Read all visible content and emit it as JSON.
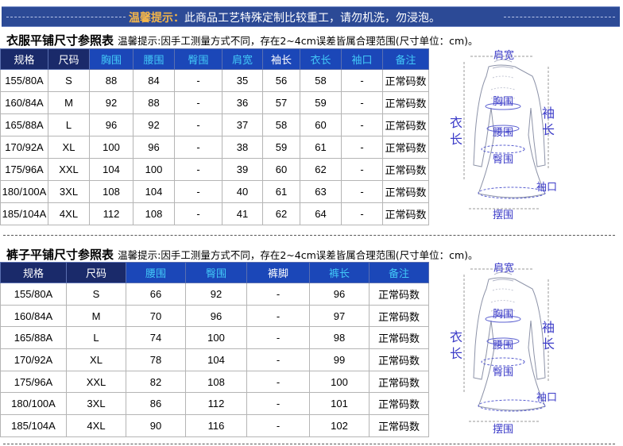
{
  "banner": {
    "lead": "温馨提示：",
    "text": "此商品工艺特殊定制比较重工，请勿机洗，勿浸泡。"
  },
  "top_section": {
    "title": "衣服平铺尺寸参照表",
    "note": "温馨提示:因手工测量方式不同，存在2~4cm误差皆属合理范围(尺寸单位：cm)。",
    "headers": [
      "规格",
      "尺码",
      "胸围",
      "腰围",
      "臀围",
      "肩宽",
      "袖长",
      "衣长",
      "袖口",
      "备注"
    ],
    "rows": [
      [
        "155/80A",
        "S",
        "88",
        "84",
        "-",
        "35",
        "56",
        "58",
        "-",
        "正常码数"
      ],
      [
        "160/84A",
        "M",
        "92",
        "88",
        "-",
        "36",
        "57",
        "59",
        "-",
        "正常码数"
      ],
      [
        "165/88A",
        "L",
        "96",
        "92",
        "-",
        "37",
        "58",
        "60",
        "-",
        "正常码数"
      ],
      [
        "170/92A",
        "XL",
        "100",
        "96",
        "-",
        "38",
        "59",
        "61",
        "-",
        "正常码数"
      ],
      [
        "175/96A",
        "XXL",
        "104",
        "100",
        "-",
        "39",
        "60",
        "62",
        "-",
        "正常码数"
      ],
      [
        "180/100A",
        "3XL",
        "108",
        "104",
        "-",
        "40",
        "61",
        "63",
        "-",
        "正常码数"
      ],
      [
        "185/104A",
        "4XL",
        "112",
        "108",
        "-",
        "41",
        "62",
        "64",
        "-",
        "正常码数"
      ]
    ]
  },
  "bottom_section": {
    "title": "裤子平铺尺寸参照表",
    "note": "温馨提示:因手工测量方式不同，存在2~4cm误差皆属合理范围(尺寸单位：cm)。",
    "headers": [
      "规格",
      "尺码",
      "腰围",
      "臀围",
      "裤脚",
      "裤长",
      "备注"
    ],
    "rows": [
      [
        "155/80A",
        "S",
        "66",
        "92",
        "-",
        "96",
        "正常码数"
      ],
      [
        "160/84A",
        "M",
        "70",
        "96",
        "-",
        "97",
        "正常码数"
      ],
      [
        "165/88A",
        "L",
        "74",
        "100",
        "-",
        "98",
        "正常码数"
      ],
      [
        "170/92A",
        "XL",
        "78",
        "104",
        "-",
        "99",
        "正常码数"
      ],
      [
        "175/96A",
        "XXL",
        "82",
        "108",
        "-",
        "100",
        "正常码数"
      ],
      [
        "180/100A",
        "3XL",
        "86",
        "112",
        "-",
        "101",
        "正常码数"
      ],
      [
        "185/104A",
        "4XL",
        "90",
        "116",
        "-",
        "102",
        "正常码数"
      ]
    ]
  },
  "diagram_labels": {
    "shoulder": "肩宽",
    "chest": "胸围",
    "waist": "腰围",
    "hip": "臀围",
    "hem": "摆围",
    "cuff": "袖口",
    "length_1": "衣",
    "length_2": "长",
    "sleeve_1": "袖",
    "sleeve_2": "长"
  },
  "colors": {
    "banner_bg": "#2c4a96",
    "banner_lead": "#f4b64a",
    "header_dark": "#1a2a6a",
    "header_blue": "#1b47b8",
    "header_cyan_text": "#42c8f8",
    "diagram_label": "#3b3bc8"
  }
}
